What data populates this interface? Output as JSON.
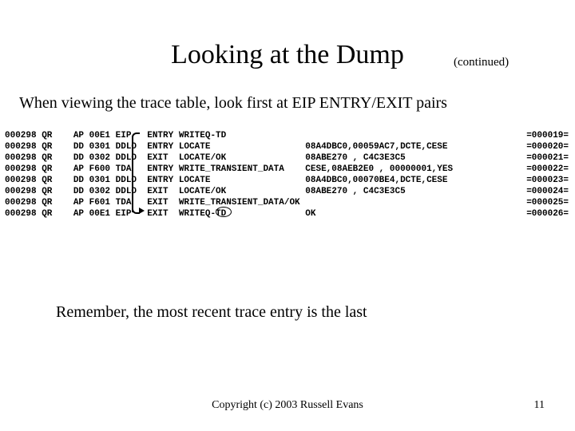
{
  "title": "Looking at the Dump",
  "continued": "(continued)",
  "subtitle": "When viewing the trace table, look first at EIP ENTRY/EXIT pairs",
  "trace_rows": [
    "000298 QR    AP 00E1 EIP   ENTRY WRITEQ-TD",
    "000298 QR    DD 0301 DDLO  ENTRY LOCATE                  08A4DBC0,00059AC7,DCTE,CESE",
    "000298 QR    DD 0302 DDLO  EXIT  LOCATE/OK               08ABE270 , C4C3E3C5",
    "000298 QR    AP F600 TDA   ENTRY WRITE_TRANSIENT_DATA    CESE,08AEB2E0 , 00000001,YES",
    "000298 QR    DD 0301 DDLO  ENTRY LOCATE                  08A4DBC0,00070BE4,DCTE,CESE",
    "000298 QR    DD 0302 DDLO  EXIT  LOCATE/OK               08ABE270 , C4C3E3C5",
    "000298 QR    AP F601 TDA   EXIT  WRITE_TRANSIENT_DATA/OK",
    "000298 QR    AP 00E1 EIP   EXIT  WRITEQ-TD               OK"
  ],
  "seq_rows": [
    "=000019=",
    "=000020=",
    "=000021=",
    "=000022=",
    "=000023=",
    "=000024=",
    "=000025=",
    "=000026="
  ],
  "note": "Remember, the most recent trace entry is the last",
  "copyright": "Copyright (c) 2003 Russell Evans",
  "page": "11"
}
